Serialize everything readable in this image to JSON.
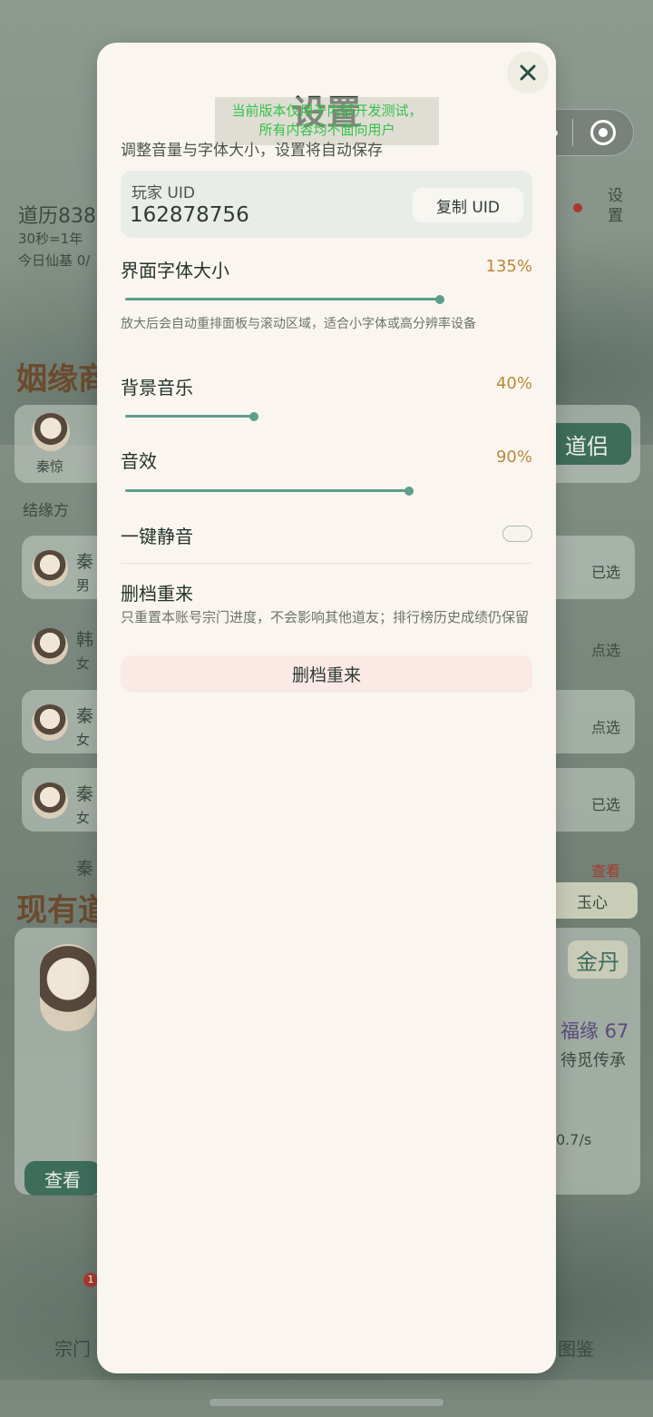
{
  "background": {
    "dao_history": "道历838",
    "time_rate": "30秒=1年",
    "daily_foundation": "今日仙基 0/",
    "settings_label": "设置",
    "marriage_title": "姻缘商",
    "selected_name": "秦惊",
    "daolv_button": "道侣",
    "bond_label": "结缘方",
    "candidates": [
      {
        "name": "秦",
        "gender": "男",
        "action": "已选"
      },
      {
        "name": "韩",
        "gender": "女",
        "action": "点选"
      },
      {
        "name": "秦",
        "gender": "女",
        "action": "点选"
      },
      {
        "name": "秦",
        "gender": "女",
        "action": "已选"
      },
      {
        "name": "秦",
        "gender": "",
        "action": "查看"
      }
    ],
    "current_daolv_title": "现有道",
    "jade_heart": "玉心",
    "realm": "金丹",
    "fortune": "福缘 67",
    "pending_inheritance": "待觅传承",
    "rate": "0.7/s",
    "view_button": "查看",
    "nav_sect": "宗门",
    "nav_atlas": "图鉴",
    "badge": "1"
  },
  "capsule": {
    "more_icon": "more-dots-icon",
    "close_icon": "target-circle-icon"
  },
  "settings": {
    "title": "设置",
    "dev_notice_line1": "当前版本仅用于内部开发测试，",
    "dev_notice_line2": "所有内容均不面向用户",
    "subtitle": "调整音量与字体大小，设置将自动保存",
    "uid_label": "玩家 UID",
    "uid_value": "162878756",
    "copy_uid": "复制 UID",
    "font_size_label": "界面字体大小",
    "font_size_value": "135%",
    "font_size_level": 1.35,
    "font_hint": "放大后会自动重排面板与滚动区域，适合小字体或高分辨率设备",
    "bgm_label": "背景音乐",
    "bgm_value": "40%",
    "bgm_level": 0.4,
    "sfx_label": "音效",
    "sfx_value": "90%",
    "sfx_level": 0.9,
    "mute_label": "一键静音",
    "mute_on": false,
    "reset_label": "删档重来",
    "reset_hint": "只重置本账号宗门进度，不会影响其他道友；排行榜历史成绩仍保留",
    "reset_button": "删档重来",
    "close_icon": "close-icon"
  },
  "colors": {
    "accent": "#5e9e8b",
    "value_gold": "#b8893a",
    "notice_green": "#33c24a",
    "danger_bg": "#fbe9e6"
  }
}
